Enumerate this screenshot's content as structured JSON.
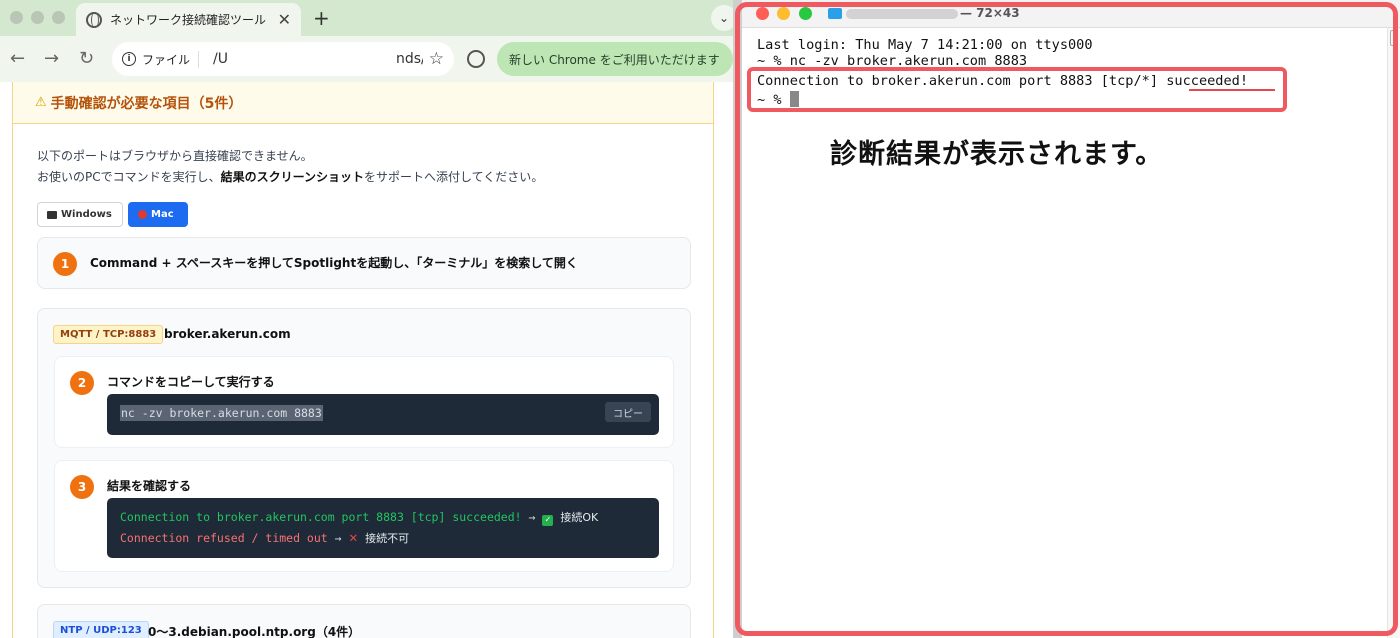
{
  "browser": {
    "tab_title": "ネットワーク接続確認ツール",
    "tab_close": "✕",
    "new_tab": "+",
    "tab_search": "⌄",
    "back": "←",
    "forward": "→",
    "reload": "↻",
    "scheme_label": "ファイル",
    "url": "/U            nds/...",
    "bookmark": "☆",
    "update_label": "新しい Chrome をご利用いただけます",
    "menu": "⋮"
  },
  "page": {
    "section_title": "手動確認が必要な項目（5件）",
    "warning_glyph": "⚠",
    "intro_line1": "以下のポートはブラウザから直接確認できません。",
    "intro_line2_pre": "お使いのPCでコマンドを実行し、",
    "intro_line2_bold": "結果のスクリーンショット",
    "intro_line2_post": "をサポートへ添付してください。",
    "os_tabs": {
      "windows": "Windows",
      "mac": "Mac"
    },
    "step1": {
      "num": "1",
      "text": "Command + スペースキーを押してSpotlightを起動し、「ターミナル」を検索して開く"
    },
    "mqtt": {
      "tag": "MQTT / TCP:8883",
      "host": "broker.akerun.com",
      "step2": {
        "num": "2",
        "text": "コマンドをコピーして実行する",
        "command": "nc -zv broker.akerun.com 8883",
        "copy": "コピー"
      },
      "step3": {
        "num": "3",
        "text": "結果を確認する",
        "ok_line": "Connection to broker.akerun.com port 8883 [tcp] succeeded!",
        "ok_arrow": "→",
        "ok_label": "接続OK",
        "ng_line": "Connection refused / timed out",
        "ng_arrow": "→",
        "ng_label": "接続不可"
      }
    },
    "ntp": {
      "tag": "NTP / UDP:123",
      "host": "0〜3.debian.pool.ntp.org（4件）"
    }
  },
  "terminal": {
    "title_size": "— 72×43",
    "line1": "Last login: Thu May  7 14:21:00 on ttys000",
    "line2": "~ % nc -zv broker.akerun.com 8883",
    "line3": "Connection to broker.akerun.com port 8883 [tcp/*] succeeded!",
    "line4": "~ % ",
    "caption": "診断結果が表示されます。"
  },
  "colors": {
    "highlight": "#ee5a5f",
    "accent": "#1d6bf0",
    "step_badge": "#f0710f"
  }
}
